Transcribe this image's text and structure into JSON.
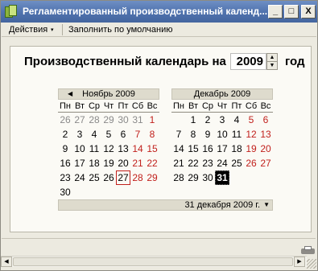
{
  "window": {
    "title": "Регламентированный производственный календ...",
    "icons": {
      "app": "calendar-app-icon",
      "min": "minimize-icon",
      "max": "maximize-icon",
      "close": "close-icon"
    },
    "buttons": {
      "minimize": "_",
      "maximize": "□",
      "close": "X"
    }
  },
  "menu": {
    "actions_label": "Действия",
    "actions_caret": "▾",
    "fill_default_label": "Заполнить по умолчанию"
  },
  "heading": {
    "prefix": "Производственный календарь на",
    "year": "2009",
    "suffix": "год",
    "spin_up": "▲",
    "spin_down": "▼"
  },
  "weekdays": [
    "Пн",
    "Вт",
    "Ср",
    "Чт",
    "Пт",
    "Сб",
    "Вс"
  ],
  "months": [
    {
      "title": "Ноябрь 2009",
      "nav": "◀",
      "days": [
        [
          "26",
          "grey"
        ],
        [
          "27",
          "grey"
        ],
        [
          "28",
          "grey"
        ],
        [
          "29",
          "grey"
        ],
        [
          "30",
          "grey"
        ],
        [
          "31",
          "grey"
        ],
        [
          "1",
          "red"
        ],
        [
          "2",
          ""
        ],
        [
          "3",
          ""
        ],
        [
          "4",
          ""
        ],
        [
          "5",
          ""
        ],
        [
          "6",
          ""
        ],
        [
          "7",
          "red"
        ],
        [
          "8",
          "red"
        ],
        [
          "9",
          ""
        ],
        [
          "10",
          ""
        ],
        [
          "11",
          ""
        ],
        [
          "12",
          ""
        ],
        [
          "13",
          ""
        ],
        [
          "14",
          "red"
        ],
        [
          "15",
          "red"
        ],
        [
          "16",
          ""
        ],
        [
          "17",
          ""
        ],
        [
          "18",
          ""
        ],
        [
          "19",
          ""
        ],
        [
          "20",
          ""
        ],
        [
          "21",
          "red"
        ],
        [
          "22",
          "red"
        ],
        [
          "23",
          ""
        ],
        [
          "24",
          ""
        ],
        [
          "25",
          ""
        ],
        [
          "26",
          ""
        ],
        [
          "27",
          "today"
        ],
        [
          "28",
          "red"
        ],
        [
          "29",
          "red"
        ],
        [
          "30",
          ""
        ]
      ]
    },
    {
      "title": "Декабрь 2009",
      "nav": "",
      "days": [
        [
          "",
          ""
        ],
        [
          "1",
          ""
        ],
        [
          "2",
          ""
        ],
        [
          "3",
          ""
        ],
        [
          "4",
          ""
        ],
        [
          "5",
          "red"
        ],
        [
          "6",
          "red"
        ],
        [
          "7",
          ""
        ],
        [
          "8",
          ""
        ],
        [
          "9",
          ""
        ],
        [
          "10",
          ""
        ],
        [
          "11",
          ""
        ],
        [
          "12",
          "red"
        ],
        [
          "13",
          "red"
        ],
        [
          "14",
          ""
        ],
        [
          "15",
          ""
        ],
        [
          "16",
          ""
        ],
        [
          "17",
          ""
        ],
        [
          "18",
          ""
        ],
        [
          "19",
          "red"
        ],
        [
          "20",
          "red"
        ],
        [
          "21",
          ""
        ],
        [
          "22",
          ""
        ],
        [
          "23",
          ""
        ],
        [
          "24",
          ""
        ],
        [
          "25",
          ""
        ],
        [
          "26",
          "red"
        ],
        [
          "27",
          "red"
        ],
        [
          "28",
          ""
        ],
        [
          "29",
          ""
        ],
        [
          "30",
          ""
        ],
        [
          "31",
          "sel"
        ]
      ]
    }
  ],
  "selected_date": {
    "text": "31 декабря 2009 г.",
    "caret": "▼"
  },
  "scrollbar": {
    "left": "◀",
    "right": "▶"
  },
  "colors": {
    "titlebar": "#4f72ad",
    "holiday_red": "#c1201c",
    "inactive_grey": "#8a8a8a",
    "selected_bg": "#000000"
  }
}
